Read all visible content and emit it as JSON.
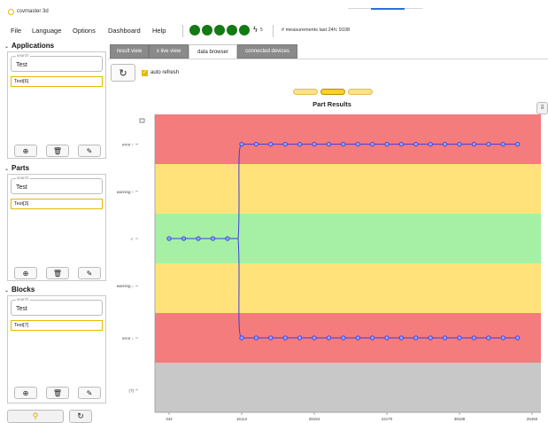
{
  "window": {
    "title": "csvmaster 3d"
  },
  "menu": {
    "items": [
      "File",
      "Language",
      "Options",
      "Dashboard",
      "Help"
    ],
    "status_count": "5",
    "measurements": "# measurements last 24h: 9108"
  },
  "applications": {
    "heading": "Applications",
    "search_label": "search",
    "search_value": "Test",
    "selected_item": "Test[6]"
  },
  "parts": {
    "heading": "Parts",
    "search_label": "search",
    "search_value": "Test",
    "selected_item": "Test[3]"
  },
  "blocks": {
    "heading": "Blocks",
    "search_label": "search",
    "search_value": "Test",
    "selected_item": "Test[7]"
  },
  "tabs": [
    "result view",
    "x live view",
    "data browser",
    "connected devices"
  ],
  "active_tab": "data browser",
  "toolbar": {
    "auto_refresh_label": "auto refresh",
    "auto_refresh_checked": true
  },
  "pager": {
    "pages": 3,
    "active": 2
  },
  "colors": {
    "error": "#f47c7c",
    "warning": "#ffe27a",
    "ok": "#a6f0a6",
    "undefined": "#c8c8c8",
    "line": "#3c3ce0",
    "accent": "#e8b800",
    "status_dot": "#147a14"
  },
  "chart_data": {
    "type": "line",
    "title": "Part Results",
    "y_categories": [
      "",
      "error ↑",
      "warning ↑",
      "✓",
      "warning ↓",
      "error ↓",
      "(?)"
    ],
    "x_ticks": [
      "342",
      "16112",
      "28154",
      "24170",
      "38188",
      "25450"
    ],
    "series": [
      {
        "values_before": [
          "✓",
          "✓",
          "✓",
          "✓",
          "✓"
        ],
        "values_after_upper": 20,
        "values_after_lower": 20
      }
    ]
  }
}
